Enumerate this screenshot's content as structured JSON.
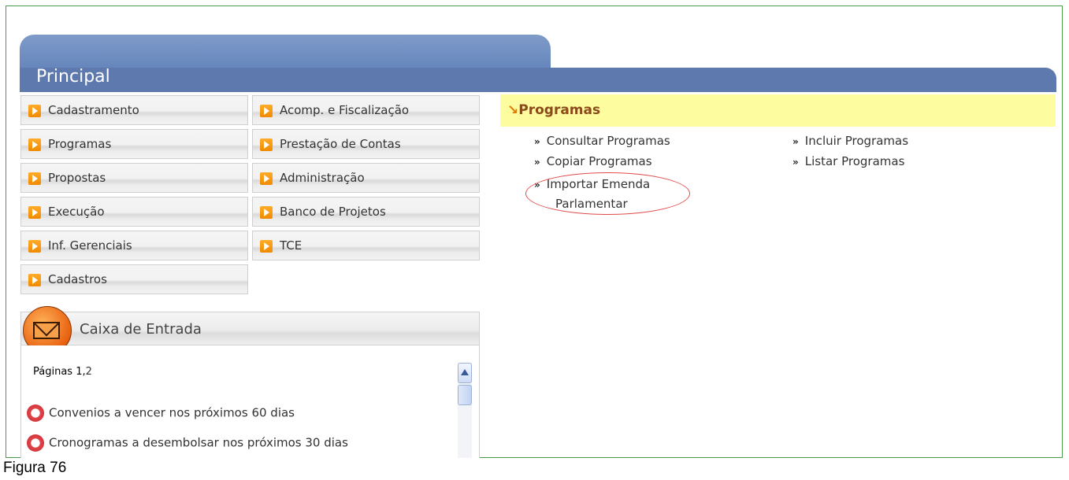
{
  "header": {
    "title": "Principal"
  },
  "menu": [
    {
      "label": "Cadastramento"
    },
    {
      "label": "Acomp. e Fiscalização"
    },
    {
      "label": "Programas"
    },
    {
      "label": "Prestação de Contas"
    },
    {
      "label": "Propostas"
    },
    {
      "label": "Administração"
    },
    {
      "label": "Execução"
    },
    {
      "label": "Banco de Projetos"
    },
    {
      "label": "Inf. Gerenciais"
    },
    {
      "label": "TCE"
    },
    {
      "label": "Cadastros"
    }
  ],
  "inbox": {
    "title": "Caixa de Entrada",
    "pages_label": "Páginas",
    "page_current": "1",
    "page_sep": ",",
    "page_other": "2",
    "items": [
      {
        "label": "Convenios a vencer nos próximos 60 dias"
      },
      {
        "label": "Cronogramas a desembolsar nos próximos 30 dias"
      }
    ]
  },
  "programas": {
    "prefix": "↘",
    "title": "Programas",
    "chevron": "»",
    "links": [
      {
        "label": "Consultar Programas"
      },
      {
        "label": "Incluir Programas"
      },
      {
        "label": "Copiar Programas"
      },
      {
        "label": "Listar Programas"
      },
      {
        "label": "Importar Emenda"
      },
      {
        "label": "Parlamentar"
      }
    ]
  },
  "caption": "Figura 76"
}
